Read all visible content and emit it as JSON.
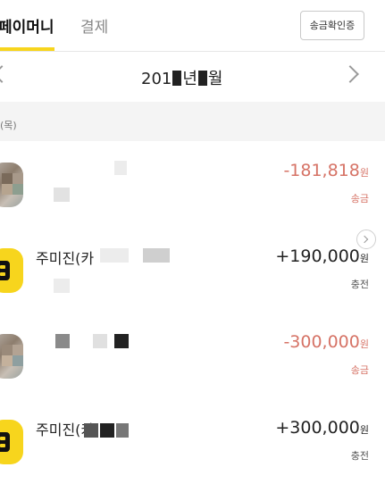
{
  "tabs": {
    "active_label": "페이머니",
    "second_label": "결제",
    "verify_button": "송금확인증"
  },
  "month": {
    "prefix": "201",
    "year_suffix": "년",
    "month_suffix": "월"
  },
  "date_header": "(목)",
  "transactions": [
    {
      "name": "",
      "amount": "-181,818",
      "unit": "원",
      "type": "송금",
      "direction": "out",
      "avatar": "photo"
    },
    {
      "name": "주미진(카",
      "amount": "+190,000",
      "unit": "원",
      "type": "충전",
      "direction": "in",
      "avatar": "kakao"
    },
    {
      "name": "",
      "amount": "-300,000",
      "unit": "원",
      "type": "송금",
      "direction": "out",
      "avatar": "photo"
    },
    {
      "name": "주미진(카",
      "amount": "+300,000",
      "unit": "원",
      "type": "충전",
      "direction": "in",
      "avatar": "kakao"
    }
  ],
  "colors": {
    "accent": "#f7d51d",
    "outgoing": "#d67366",
    "incoming": "#222222"
  }
}
